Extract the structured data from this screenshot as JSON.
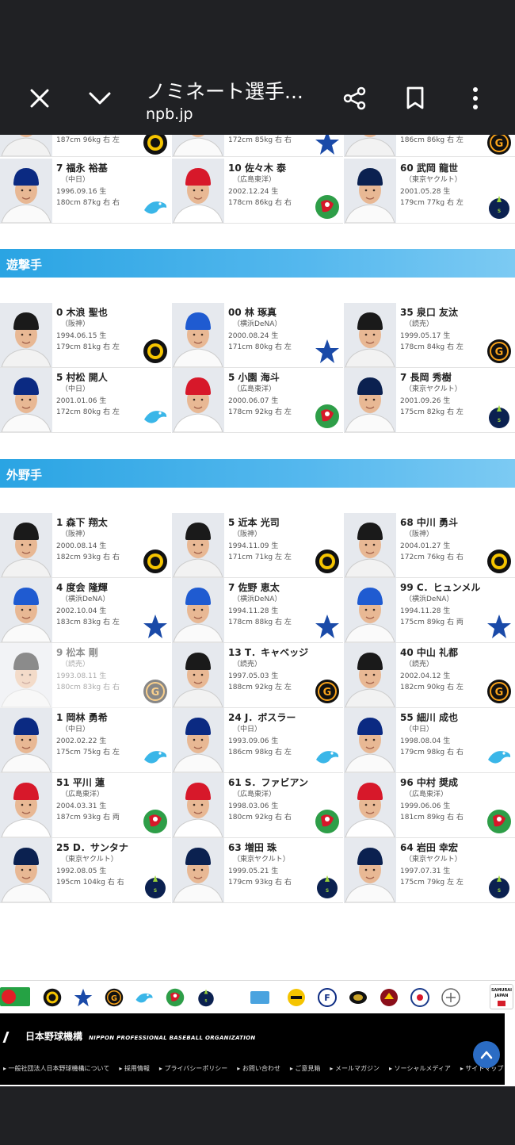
{
  "browser": {
    "title": "ノミネート選手...",
    "domain": "npb.jp",
    "icons": [
      "close-icon",
      "chevron-down-icon",
      "share-icon",
      "bookmark-icon",
      "more-vert-icon"
    ]
  },
  "colors": {
    "section_band": "#2aa4e3",
    "tigers": "#111111",
    "dragons": "#0b2a82",
    "carp": "#d7182a",
    "baystars": "#1a4aa8",
    "giants": "#f26b1f",
    "swallows": "#0b2150"
  },
  "partial_top": {
    "rows": [
      {
        "body": "187cm 96kg 右 左"
      },
      {
        "body": "172cm 85kg 右 右"
      },
      {
        "body": "186cm 86kg 右 左"
      }
    ]
  },
  "top_group": {
    "players": [
      {
        "name": "7 福永 裕基",
        "team": "（中日）",
        "birth": "1996.09.16 生",
        "body": "180cm 87kg 右 右",
        "team_key": "dragons"
      },
      {
        "name": "10 佐々木 泰",
        "team": "（広島東洋）",
        "birth": "2002.12.24 生",
        "body": "178cm 86kg 右 右",
        "team_key": "carp"
      },
      {
        "name": "60 武岡 龍世",
        "team": "（東京ヤクルト）",
        "birth": "2001.05.28 生",
        "body": "179cm 77kg 右 左",
        "team_key": "swallows"
      }
    ]
  },
  "sections": [
    {
      "title": "遊撃手",
      "players": [
        {
          "name": "0 木浪 聖也",
          "team": "（阪神）",
          "birth": "1994.06.15 生",
          "body": "179cm 81kg 右 左",
          "team_key": "tigers"
        },
        {
          "name": "00 林 琢真",
          "team": "（横浜DeNA）",
          "birth": "2000.08.24 生",
          "body": "171cm 80kg 右 左",
          "team_key": "baystars"
        },
        {
          "name": "35 泉口 友汰",
          "team": "（読売）",
          "birth": "1999.05.17 生",
          "body": "178cm 84kg 右 左",
          "team_key": "giants"
        },
        {
          "name": "5 村松 開人",
          "team": "（中日）",
          "birth": "2001.01.06 生",
          "body": "172cm 80kg 右 左",
          "team_key": "dragons"
        },
        {
          "name": "5 小園 海斗",
          "team": "（広島東洋）",
          "birth": "2000.06.07 生",
          "body": "178cm 92kg 右 左",
          "team_key": "carp"
        },
        {
          "name": "7 長岡 秀樹",
          "team": "（東京ヤクルト）",
          "birth": "2001.09.26 生",
          "body": "175cm 82kg 右 左",
          "team_key": "swallows"
        }
      ]
    },
    {
      "title": "外野手",
      "players": [
        {
          "name": "1 森下 翔太",
          "team": "（阪神）",
          "birth": "2000.08.14 生",
          "body": "182cm 93kg 右 右",
          "team_key": "tigers"
        },
        {
          "name": "5 近本 光司",
          "team": "（阪神）",
          "birth": "1994.11.09 生",
          "body": "171cm 71kg 左 左",
          "team_key": "tigers"
        },
        {
          "name": "68 中川 勇斗",
          "team": "（阪神）",
          "birth": "2004.01.27 生",
          "body": "172cm 76kg 右 右",
          "team_key": "tigers"
        },
        {
          "name": "4 度会 隆輝",
          "team": "（横浜DeNA）",
          "birth": "2002.10.04 生",
          "body": "183cm 83kg 右 左",
          "team_key": "baystars"
        },
        {
          "name": "7 佐野 恵太",
          "team": "（横浜DeNA）",
          "birth": "1994.11.28 生",
          "body": "178cm 88kg 右 左",
          "team_key": "baystars"
        },
        {
          "name": "99 C．ヒュンメル",
          "team": "（横浜DeNA）",
          "birth": "1994.11.28 生",
          "body": "175cm 89kg 右 両",
          "team_key": "baystars"
        },
        {
          "name": "9 松本 剛",
          "team": "（読売）",
          "birth": "1993.08.11 生",
          "body": "180cm 83kg 右 右",
          "team_key": "giants",
          "faded": true
        },
        {
          "name": "13 T．キャベッジ",
          "team": "（読売）",
          "birth": "1997.05.03 生",
          "body": "188cm 92kg 左 左",
          "team_key": "giants"
        },
        {
          "name": "40 中山 礼都",
          "team": "（読売）",
          "birth": "2002.04.12 生",
          "body": "182cm 90kg 右 左",
          "team_key": "giants"
        },
        {
          "name": "1 岡林 勇希",
          "team": "（中日）",
          "birth": "2002.02.22 生",
          "body": "175cm 75kg 右 左",
          "team_key": "dragons"
        },
        {
          "name": "24 J．ボスラー",
          "team": "（中日）",
          "birth": "1993.09.06 生",
          "body": "186cm 98kg 右 左",
          "team_key": "dragons"
        },
        {
          "name": "55 細川 成也",
          "team": "（中日）",
          "birth": "1998.08.04 生",
          "body": "179cm 98kg 右 右",
          "team_key": "dragons"
        },
        {
          "name": "51 平川 蓮",
          "team": "（広島東洋）",
          "birth": "2004.03.31 生",
          "body": "187cm 93kg 右 両",
          "team_key": "carp"
        },
        {
          "name": "61 S．ファビアン",
          "team": "（広島東洋）",
          "birth": "1998.03.06 生",
          "body": "180cm 92kg 右 右",
          "team_key": "carp"
        },
        {
          "name": "96 中村 奨成",
          "team": "（広島東洋）",
          "birth": "1999.06.06 生",
          "body": "181cm 89kg 右 右",
          "team_key": "carp"
        },
        {
          "name": "25 D．サンタナ",
          "team": "（東京ヤクルト）",
          "birth": "1992.08.05 生",
          "body": "195cm 104kg 右 右",
          "team_key": "swallows"
        },
        {
          "name": "63 増田 珠",
          "team": "（東京ヤクルト）",
          "birth": "1999.05.21 生",
          "body": "179cm 93kg 右 右",
          "team_key": "swallows"
        },
        {
          "name": "64 岩田 幸宏",
          "team": "（東京ヤクルト）",
          "birth": "1997.07.31 生",
          "body": "175cm 79kg 左 左",
          "team_key": "swallows"
        }
      ]
    }
  ],
  "team_bar": {
    "teams": [
      "tigers",
      "baystars",
      "giants",
      "dragons",
      "carp",
      "swallows",
      "pacific",
      "hawks",
      "fighters",
      "buffaloes",
      "eagles",
      "lions",
      "marines"
    ],
    "samurai_label": "SAMURAI JAPAN"
  },
  "footer": {
    "org_name": "日本野球機構",
    "org_name_en": "NIPPON PROFESSIONAL BASEBALL ORGANIZATION",
    "links": [
      "一般社団法人日本野球機構について",
      "採用情報",
      "プライバシーポリシー",
      "お問い合わせ",
      "ご意見箱",
      "メールマガジン",
      "ソーシャルメディア",
      "サイトマップ"
    ]
  }
}
